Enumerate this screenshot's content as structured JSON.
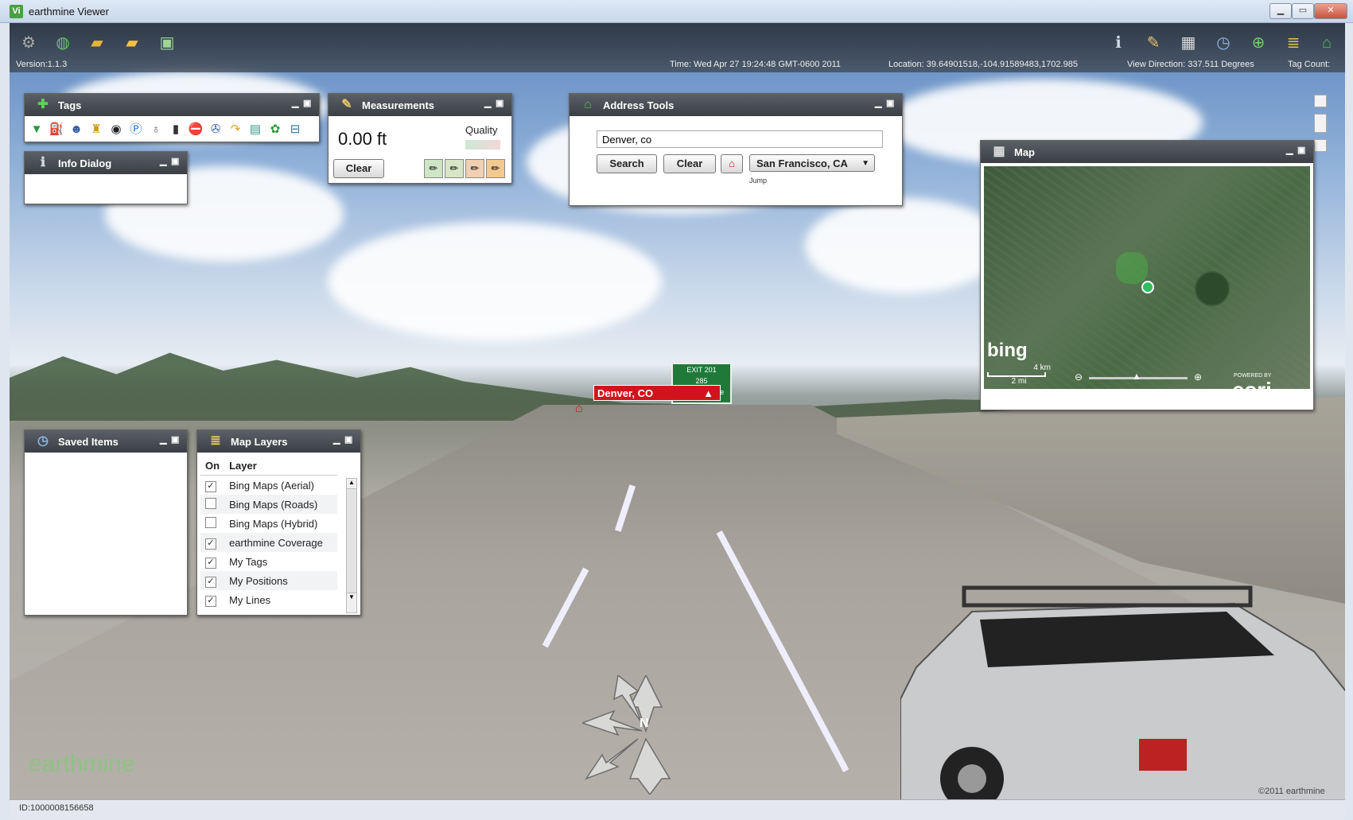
{
  "window": {
    "title": "earthmine Viewer",
    "app_icon_glyph": "Vi",
    "min": "▁",
    "max": "▭",
    "close": "✕"
  },
  "toolbar": {
    "left_icons": [
      "gear-icon",
      "globe-icon",
      "open-folder-icon",
      "folder-icon",
      "camera-icon"
    ],
    "right_icons": [
      "info-icon",
      "ruler-icon",
      "calculator-icon",
      "clock-icon",
      "add-tag-icon",
      "layers-icon",
      "home-icon"
    ],
    "version": "Version:1.1.3",
    "time": "Time: Wed Apr 27 19:24:48 GMT-0600 2011",
    "location": "Location: 39.64901518,-104.91589483,1702.985",
    "view_direction": "View Direction: 337.511 Degrees",
    "tag_count": "Tag Count:"
  },
  "tags_panel": {
    "title": "Tags",
    "icons": [
      "tag-icon",
      "gas-station-icon",
      "person-icon",
      "hydrant-icon",
      "manhole-icon",
      "parking-icon",
      "lamp-icon",
      "traffic-light-icon",
      "stop-sign-icon",
      "trash-icon",
      "pipe-icon",
      "bin-icon",
      "tree-icon",
      "bus-icon"
    ]
  },
  "info_dialog": {
    "title": "Info Dialog"
  },
  "measurements": {
    "title": "Measurements",
    "value": "0.00 ft",
    "quality_label": "Quality",
    "clear_label": "Clear"
  },
  "address_tools": {
    "title": "Address Tools",
    "input_value": "Denver, co",
    "search_label": "Search",
    "clear_label": "Clear",
    "jump_label": "Jump",
    "selected_location": "San Francisco, CA"
  },
  "map_panel": {
    "title": "Map",
    "bing": "bing",
    "scale_km": "4 km",
    "scale_mi": "2 mi",
    "esri": "esri",
    "powered_by": "POWERED BY"
  },
  "saved_items": {
    "title": "Saved Items"
  },
  "map_layers": {
    "title": "Map Layers",
    "col_on": "On",
    "col_layer": "Layer",
    "rows": [
      {
        "name": "Bing Maps (Aerial)",
        "on": true
      },
      {
        "name": "Bing Maps (Roads)",
        "on": false
      },
      {
        "name": "Bing Maps (Hybrid)",
        "on": false
      },
      {
        "name": "earthmine Coverage",
        "on": true
      },
      {
        "name": "My Tags",
        "on": true
      },
      {
        "name": "My Positions",
        "on": true
      },
      {
        "name": "My Lines",
        "on": true
      }
    ]
  },
  "scene": {
    "location_label": "Denver, CO",
    "highway_sign_exit": "EXIT 201",
    "highway_sign_route": "285",
    "highway_sign_road": "Hampden Ave",
    "watermark": "earthmine",
    "copyright": "©2011 earthmine",
    "compass_north": "N"
  },
  "statusbar": {
    "id": "ID:1000008156658"
  },
  "colors": {
    "panel_header": "#4a4e55",
    "location_label": "#d1141b",
    "accent_green": "#2a9a3a"
  }
}
